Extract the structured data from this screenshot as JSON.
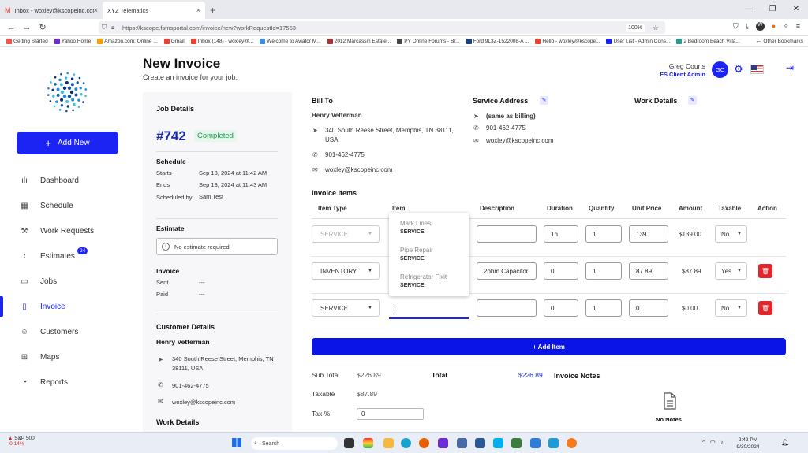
{
  "browser": {
    "tabs": [
      {
        "label": "Inbox - woxley@kscopeinc.com",
        "close": "×"
      },
      {
        "label": "XYZ Telematics",
        "close": "×"
      }
    ],
    "new_tab": "+",
    "url": "https://kscope.fsmsportal.com/invoice/new?workRequestId=17553",
    "zoom": "100%",
    "bookmarks": [
      {
        "label": "Getting Started",
        "color": "#e55"
      },
      {
        "label": "Yahoo Home",
        "color": "#6b2bd6"
      },
      {
        "label": "Amazon.com: Online ...",
        "color": "#f90"
      },
      {
        "label": "Gmail",
        "color": "#ea4335"
      },
      {
        "label": "Inbox (148) - woxley@...",
        "color": "#ea4335"
      },
      {
        "label": "Welcome to Aviator M...",
        "color": "#3a8ee6"
      },
      {
        "label": "2012 Marcassin Estate...",
        "color": "#a33"
      },
      {
        "label": "PY Online Forums - Br...",
        "color": "#444"
      },
      {
        "label": "Ford 9L3Z-1522008-A ...",
        "color": "#1c3d8c"
      },
      {
        "label": "Hello - woxley@kscope...",
        "color": "#ea4335"
      },
      {
        "label": "User List - Admin Cons...",
        "color": "#1c24f3"
      },
      {
        "label": "2 Bedroom Beach Villa...",
        "color": "#2a9d8f"
      }
    ],
    "other_bookmarks": "Other Bookmarks"
  },
  "sidebar": {
    "add_new": "Add New",
    "items": [
      {
        "label": "Dashboard",
        "icon": "bar-chart-icon",
        "glyph": "ılı"
      },
      {
        "label": "Schedule",
        "icon": "calendar-icon",
        "glyph": "▦"
      },
      {
        "label": "Work Requests",
        "icon": "wrench-icon",
        "glyph": "⚒"
      },
      {
        "label": "Estimates",
        "icon": "paperclip-icon",
        "glyph": "⌇",
        "badge": "24"
      },
      {
        "label": "Jobs",
        "icon": "folder-icon",
        "glyph": "▭"
      },
      {
        "label": "Invoice",
        "icon": "document-icon",
        "glyph": "▯"
      },
      {
        "label": "Customers",
        "icon": "users-icon",
        "glyph": "☺"
      },
      {
        "label": "Maps",
        "icon": "map-icon",
        "glyph": "⊞"
      },
      {
        "label": "Reports",
        "icon": "pie-chart-icon",
        "glyph": "◔"
      }
    ]
  },
  "header": {
    "title": "New Invoice",
    "subtitle": "Create an invoice for your job.",
    "user_name": "Greg Courts",
    "user_role": "FS Client Admin",
    "avatar": "GC"
  },
  "job": {
    "heading": "Job Details",
    "number": "#742",
    "status": "Completed",
    "schedule_heading": "Schedule",
    "starts_label": "Starts",
    "starts": "Sep 13, 2024 at 11:42 AM",
    "ends_label": "Ends",
    "ends": "Sep 13, 2024 at 11:43 AM",
    "scheduled_by_label": "Scheduled by",
    "scheduled_by": "Sam Test",
    "estimate_heading": "Estimate",
    "estimate_text": "No estimate required",
    "invoice_heading": "Invoice",
    "sent_label": "Sent",
    "sent": "---",
    "paid_label": "Paid",
    "paid": "---",
    "customer_heading": "Customer Details",
    "customer_name": "Henry Vetterman",
    "customer_address": "340 South Reese Street, Memphis, TN 38111, USA",
    "customer_phone": "901-462-4775",
    "customer_email": "woxley@kscopeinc.com",
    "work_details_heading": "Work Details"
  },
  "bill_to": {
    "heading": "Bill To",
    "name": "Henry Vetterman",
    "address": "340 South Reese Street, Memphis, TN 38111, USA",
    "phone": "901-462-4775",
    "email": "woxley@kscopeinc.com"
  },
  "service_address": {
    "heading": "Service Address",
    "same": "(same as billing)",
    "phone": "901-462-4775",
    "email": "woxley@kscopeinc.com"
  },
  "work_details": {
    "heading": "Work Details"
  },
  "invoice_items": {
    "heading": "Invoice Items",
    "columns": [
      "Item Type",
      "Item",
      "Description",
      "Duration",
      "Quantity",
      "Unit Price",
      "Amount",
      "Taxable",
      "Action"
    ],
    "rows": [
      {
        "type": "SERVICE",
        "item": "",
        "description": "",
        "duration": "1h",
        "quantity": "1",
        "unit_price": "139",
        "amount": "$139.00",
        "taxable": "No"
      },
      {
        "type": "INVENTORY",
        "item": "",
        "description": "2ohm Capacitor",
        "duration": "0",
        "quantity": "1",
        "unit_price": "87.89",
        "amount": "$87.89",
        "taxable": "Yes"
      },
      {
        "type": "SERVICE",
        "item": "",
        "description": "",
        "duration": "0",
        "quantity": "1",
        "unit_price": "0",
        "amount": "$0.00",
        "taxable": "No"
      }
    ],
    "dropdown": [
      {
        "name": "Mark Lines",
        "type": "SERVICE"
      },
      {
        "name": "Pipe Repair",
        "type": "SERVICE"
      },
      {
        "name": "Refrigerator Fixit",
        "type": "SERVICE"
      }
    ],
    "add_item": "+ Add Item"
  },
  "totals": {
    "subtotal_label": "Sub Total",
    "subtotal": "$226.89",
    "taxable_label": "Taxable",
    "taxable": "$87.89",
    "tax_label": "Tax %",
    "tax": "0",
    "total_label": "Total",
    "total": "$226.89"
  },
  "notes": {
    "heading": "Invoice Notes",
    "empty": "No Notes"
  },
  "taskbar": {
    "stock_name": "S&P 500",
    "stock_change": "-0.14%",
    "search": "Search",
    "time": "2:42 PM",
    "date": "9/30/2024"
  }
}
